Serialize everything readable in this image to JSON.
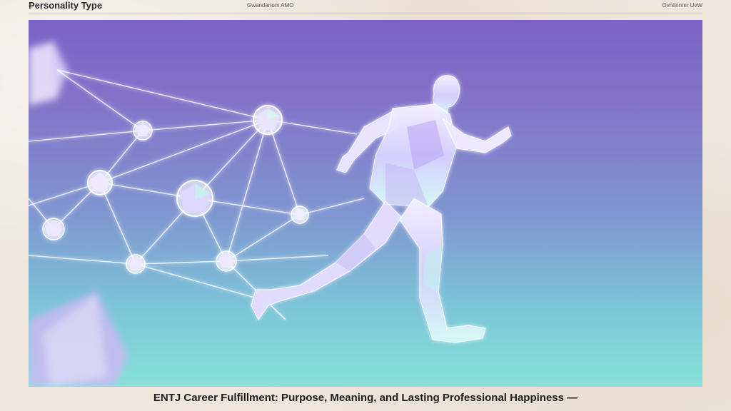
{
  "header": {
    "brand": "Personality Type",
    "meta_center": "Gwandanom AMO",
    "meta_right": "Ovnitnnmr UvW"
  },
  "illustration": {
    "subject": "runner-figure",
    "accent_colors": [
      "#7c62c6",
      "#86e2d8",
      "#ffffff"
    ]
  },
  "footer": {
    "caption": "ENTJ Career Fulfillment: Purpose, Meaning, and Lasting Professional Happiness —"
  }
}
